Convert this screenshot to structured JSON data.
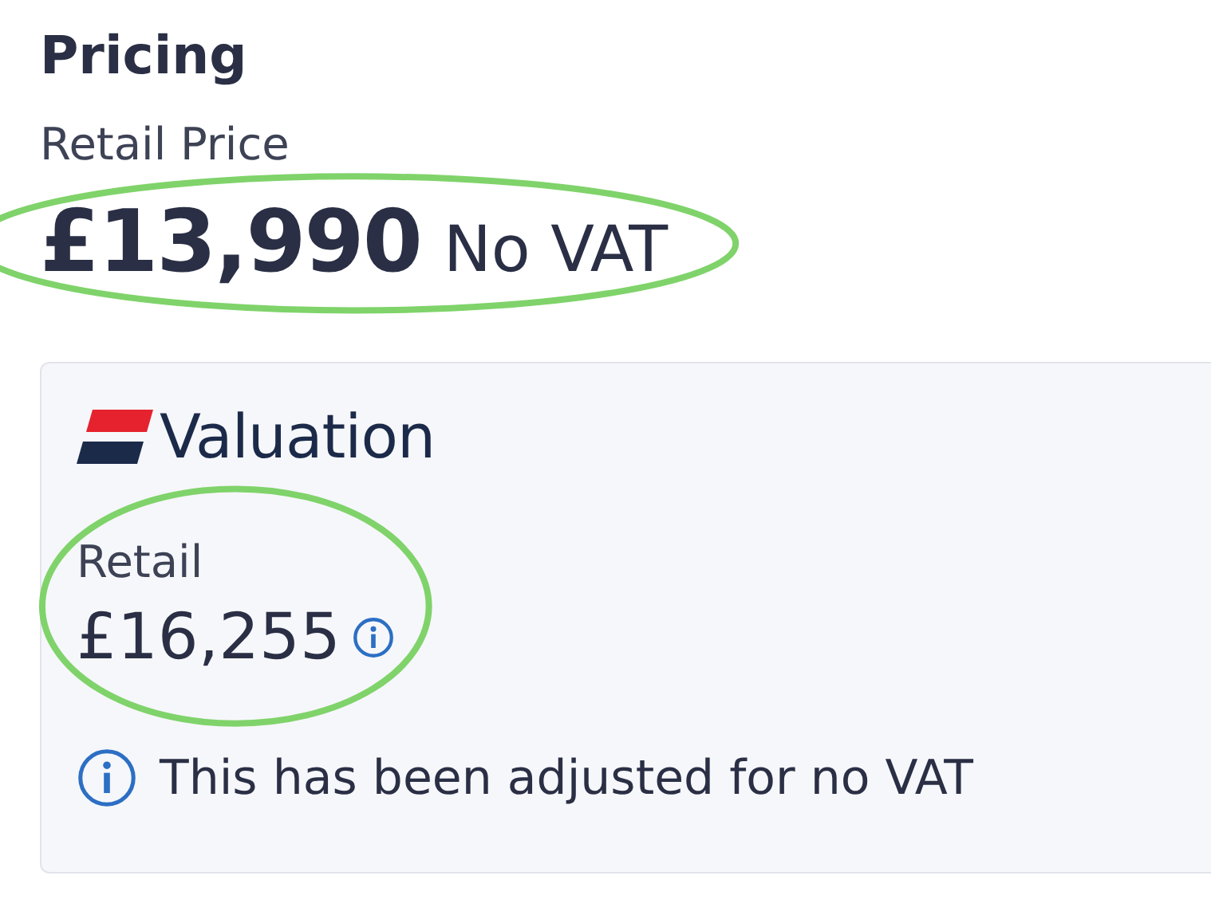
{
  "section_title": "Pricing",
  "retail_price": {
    "label": "Retail Price",
    "amount": "£13,990",
    "note": "No VAT"
  },
  "valuation": {
    "brand": "Valuation",
    "retail": {
      "label": "Retail",
      "amount": "£16,255"
    },
    "notice": "This has been adjusted for no VAT"
  }
}
